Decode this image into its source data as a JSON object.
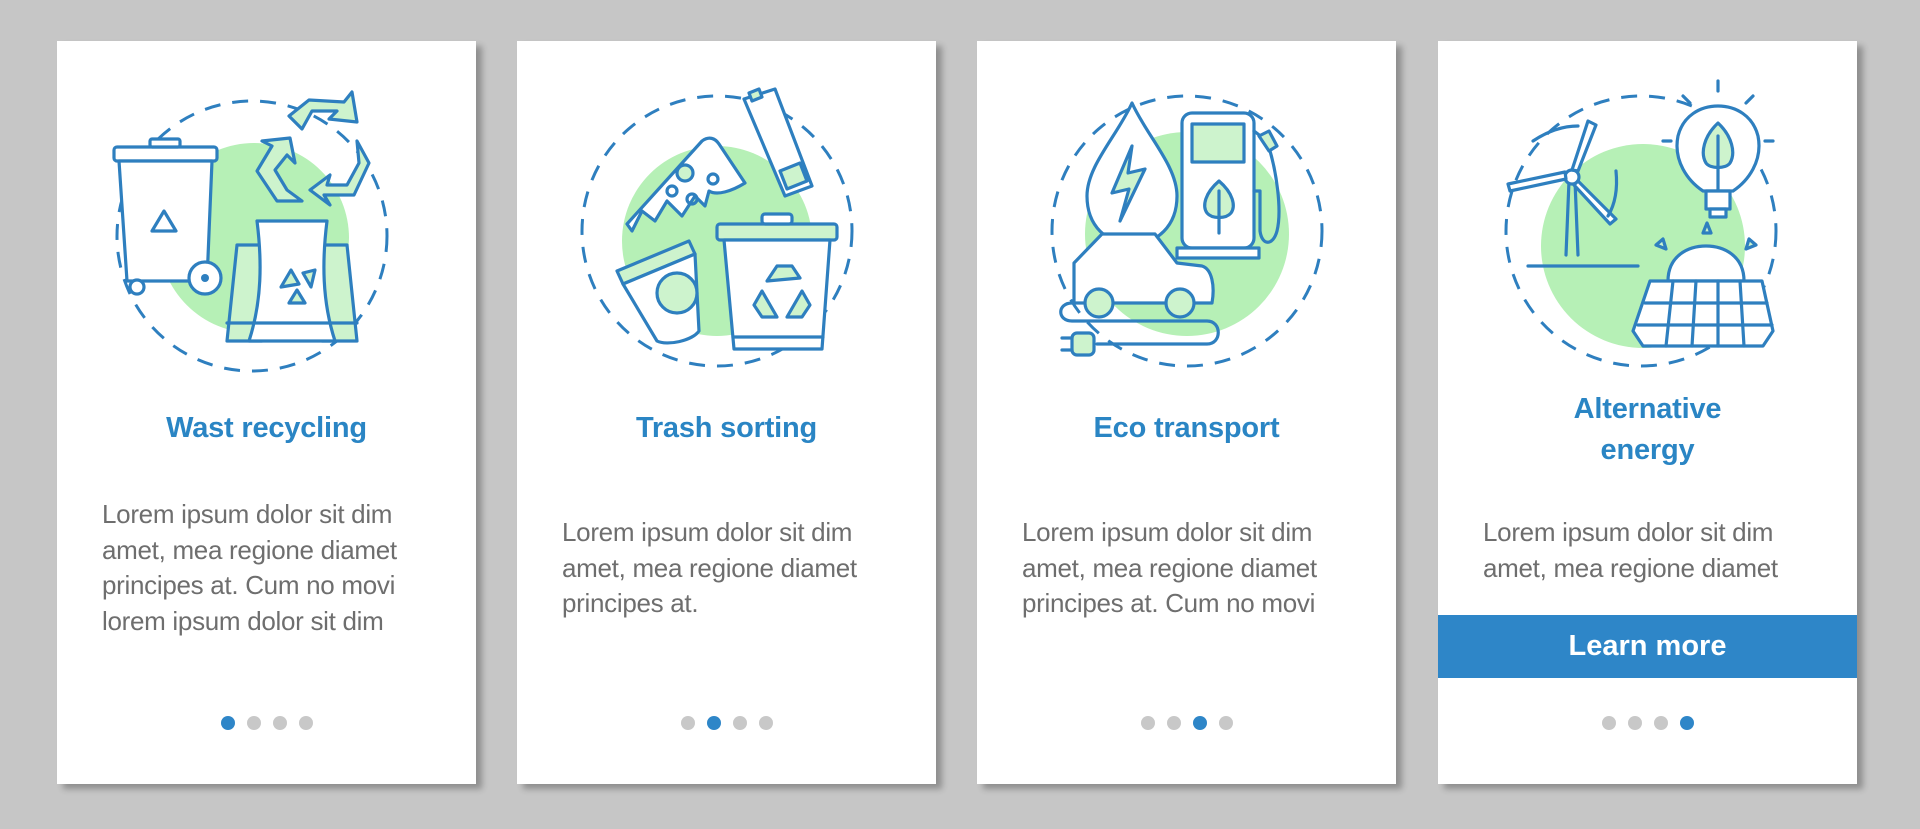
{
  "cards": [
    {
      "illustration": "waste-recycling-illustration",
      "title": "Wast recycling",
      "body": "Lorem ipsum dolor sit dim\namet, mea regione diamet\nprincipes at. Cum no movi\nlorem ipsum dolor sit dim",
      "active_page": 1
    },
    {
      "illustration": "trash-sorting-illustration",
      "title": "Trash sorting",
      "body": "Lorem ipsum dolor sit dim\namet, mea regione diamet\nprincipes at.",
      "active_page": 2
    },
    {
      "illustration": "eco-transport-illustration",
      "title": "Eco transport",
      "body": "Lorem ipsum dolor sit dim\namet, mea regione diamet\nprincipes at. Cum no movi",
      "active_page": 3
    },
    {
      "illustration": "alternative-energy-illustration",
      "title_line1": "Alternative",
      "title_line2": "energy",
      "body": "Lorem ipsum dolor sit dim\namet, mea regione diamet",
      "button_label": "Learn more",
      "active_page": 4
    }
  ],
  "pagination": {
    "total_pages": 4
  },
  "colors": {
    "accent": "#2e86c8",
    "title": "#2a85c4",
    "body_text": "#6e6e6e",
    "icon_fill": "#b6f0b6",
    "dot_inactive": "#c8c8c8",
    "background": "#c6c6c6"
  }
}
